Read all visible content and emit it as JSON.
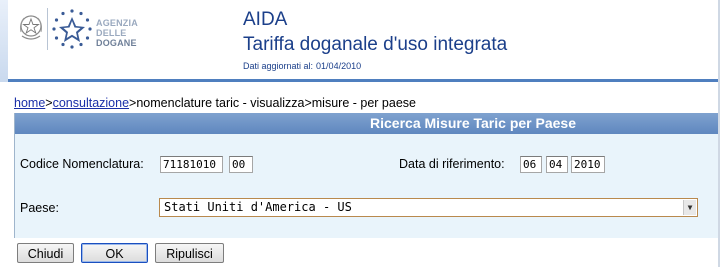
{
  "header": {
    "app_name": "AIDA",
    "app_subtitle": "Tariffa doganale d'uso integrata",
    "date_label": "Dati aggiornati al:",
    "date_value": "01/04/2010",
    "agency_lines": [
      "AGENZIA",
      "DELLE",
      "DOGANE"
    ]
  },
  "breadcrumb": {
    "home": "home",
    "sep1": ">",
    "consultazione": "consultazione",
    "rest": ">nomenclature taric - visualizza>misure - per paese"
  },
  "panel": {
    "title": "Ricerca Misure Taric per Paese",
    "codice_label": "Codice Nomenclatura:",
    "codice_value": "71181010",
    "codice_suffix": "00",
    "data_label": "Data di riferimento:",
    "data_day": "06",
    "data_month": "04",
    "data_year": "2010",
    "paese_label": "Paese:",
    "paese_value": "Stati Uniti d'America - US"
  },
  "buttons": {
    "chiudi": "Chiudi",
    "ok": "OK",
    "ripulisci": "Ripulisci"
  },
  "colors": {
    "title_blue": "#1b3f8a",
    "panel_bg": "#e9f4fb",
    "panel_header": "#5f87bf"
  },
  "icons": {
    "emblem": "italian-republic-emblem-icon",
    "logo": "agenzia-dogane-stars-icon",
    "dropdown": "chevron-down-icon"
  }
}
